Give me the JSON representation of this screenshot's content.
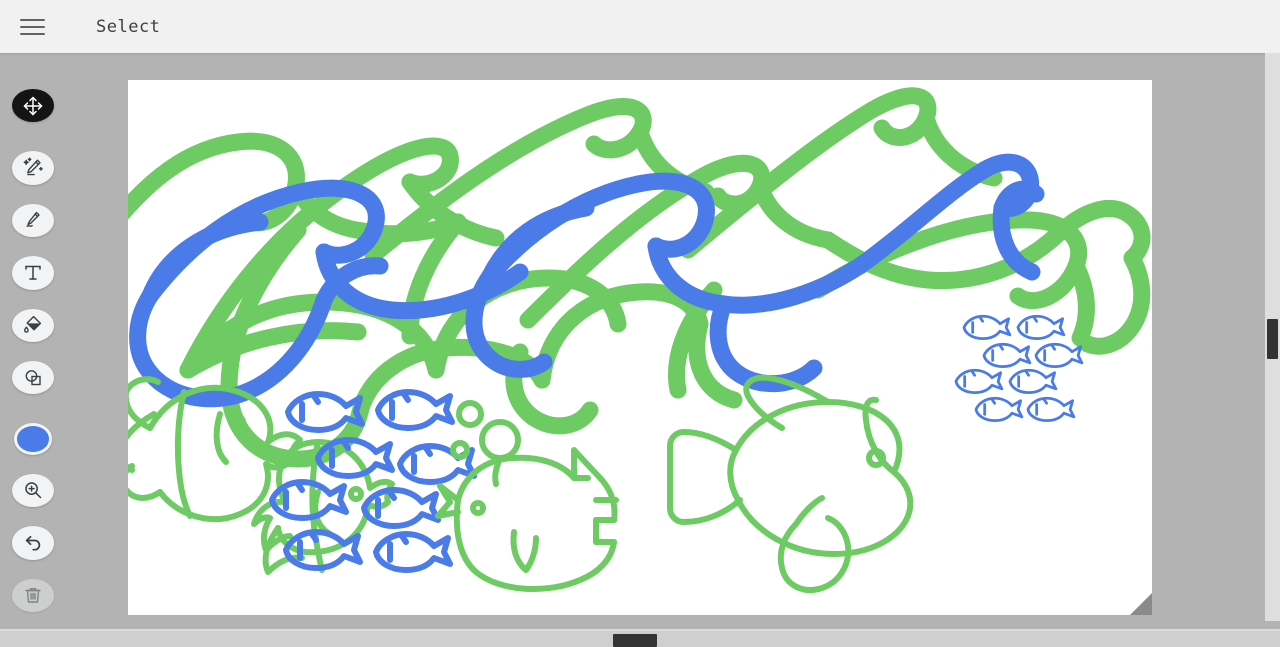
{
  "header": {
    "menu_icon": "hamburger-menu-icon",
    "title": "Select"
  },
  "toolbar": {
    "tools": [
      {
        "name": "move-tool",
        "icon": "move-arrows-icon",
        "label": "Move",
        "active": true,
        "disabled": false
      },
      {
        "name": "magic-pen-tool",
        "icon": "magic-pencil-icon",
        "label": "Magic Pen",
        "active": false,
        "disabled": false
      },
      {
        "name": "pen-tool",
        "icon": "pen-icon",
        "label": "Pen",
        "active": false,
        "disabled": false
      },
      {
        "name": "text-tool",
        "icon": "text-T-icon",
        "label": "Text",
        "active": false,
        "disabled": false
      },
      {
        "name": "fill-tool",
        "icon": "paint-bucket-icon",
        "label": "Fill",
        "active": false,
        "disabled": false
      },
      {
        "name": "shapes-tool",
        "icon": "shapes-icon",
        "label": "Shapes",
        "active": false,
        "disabled": false
      }
    ],
    "color_swatch": {
      "name": "color-swatch",
      "color": "#4a7be8",
      "label": "Blue"
    },
    "bottom_tools": [
      {
        "name": "zoom-tool",
        "icon": "magnifier-plus-icon",
        "label": "Zoom",
        "disabled": false
      },
      {
        "name": "undo-tool",
        "icon": "undo-arrow-icon",
        "label": "Undo",
        "disabled": false
      },
      {
        "name": "delete-tool",
        "icon": "trash-icon",
        "label": "Delete",
        "disabled": true
      }
    ]
  },
  "canvas": {
    "name": "drawing-canvas",
    "background": "#ffffff",
    "colors": {
      "green": "#6ecb63",
      "blue": "#4a7be8"
    },
    "stroke_width": 17,
    "objects": [
      {
        "name": "wave-strokes-green",
        "type": "waves",
        "color": "#6ecb63",
        "count": 5
      },
      {
        "name": "wave-strokes-blue",
        "type": "waves",
        "color": "#4a7be8",
        "count": 3
      },
      {
        "name": "angelfish-green",
        "type": "fish",
        "color": "#6ecb63",
        "facing": "right"
      },
      {
        "name": "fish-school-blue-large",
        "type": "fish-school",
        "color": "#4a7be8",
        "count": 8,
        "facing": "left"
      },
      {
        "name": "bubble-fish-green",
        "type": "fish",
        "color": "#6ecb63",
        "facing": "left",
        "bubbles": 3
      },
      {
        "name": "big-fish-green",
        "type": "fish",
        "color": "#6ecb63",
        "facing": "right"
      },
      {
        "name": "fish-school-blue-small",
        "type": "fish-school",
        "color": "#4a7be8",
        "count": 8,
        "facing": "left"
      }
    ],
    "resize_handle": "canvas-resize-handle"
  },
  "scrollbars": {
    "vertical": {
      "name": "vertical-scrollbar",
      "thumb": "vertical-scrollbar-thumb"
    },
    "horizontal": {
      "name": "horizontal-scrollbar",
      "thumb": "horizontal-scrollbar-thumb"
    }
  }
}
